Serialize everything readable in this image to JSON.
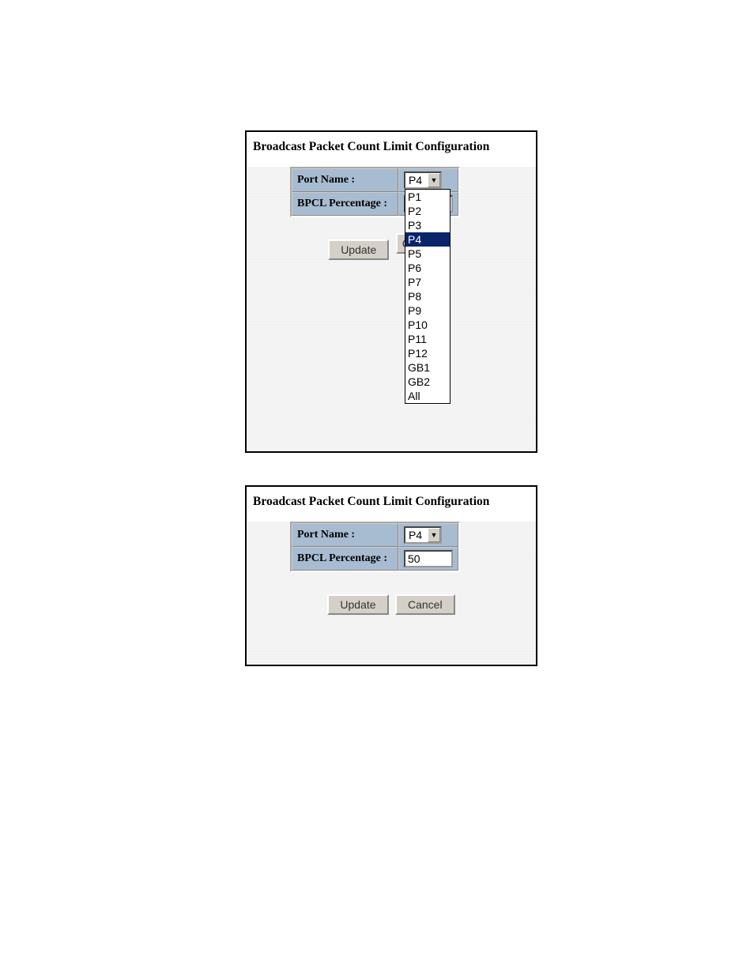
{
  "panel1": {
    "title": "Broadcast Packet Count Limit Configuration",
    "port_name_label": "Port Name :",
    "bpcl_label": "BPCL Percentage :",
    "port_selected": "P4",
    "update_label": "Update",
    "cancel_label": "C",
    "dropdown": {
      "options": [
        "P1",
        "P2",
        "P3",
        "P4",
        "P5",
        "P6",
        "P7",
        "P8",
        "P9",
        "P10",
        "P11",
        "P12",
        "GB1",
        "GB2",
        "All"
      ],
      "selected": "P4"
    }
  },
  "panel2": {
    "title": "Broadcast Packet Count Limit Configuration",
    "port_name_label": "Port Name :",
    "bpcl_label": "BPCL Percentage :",
    "port_selected": "P4",
    "bpcl_value": "50",
    "update_label": "Update",
    "cancel_label": "Cancel"
  }
}
